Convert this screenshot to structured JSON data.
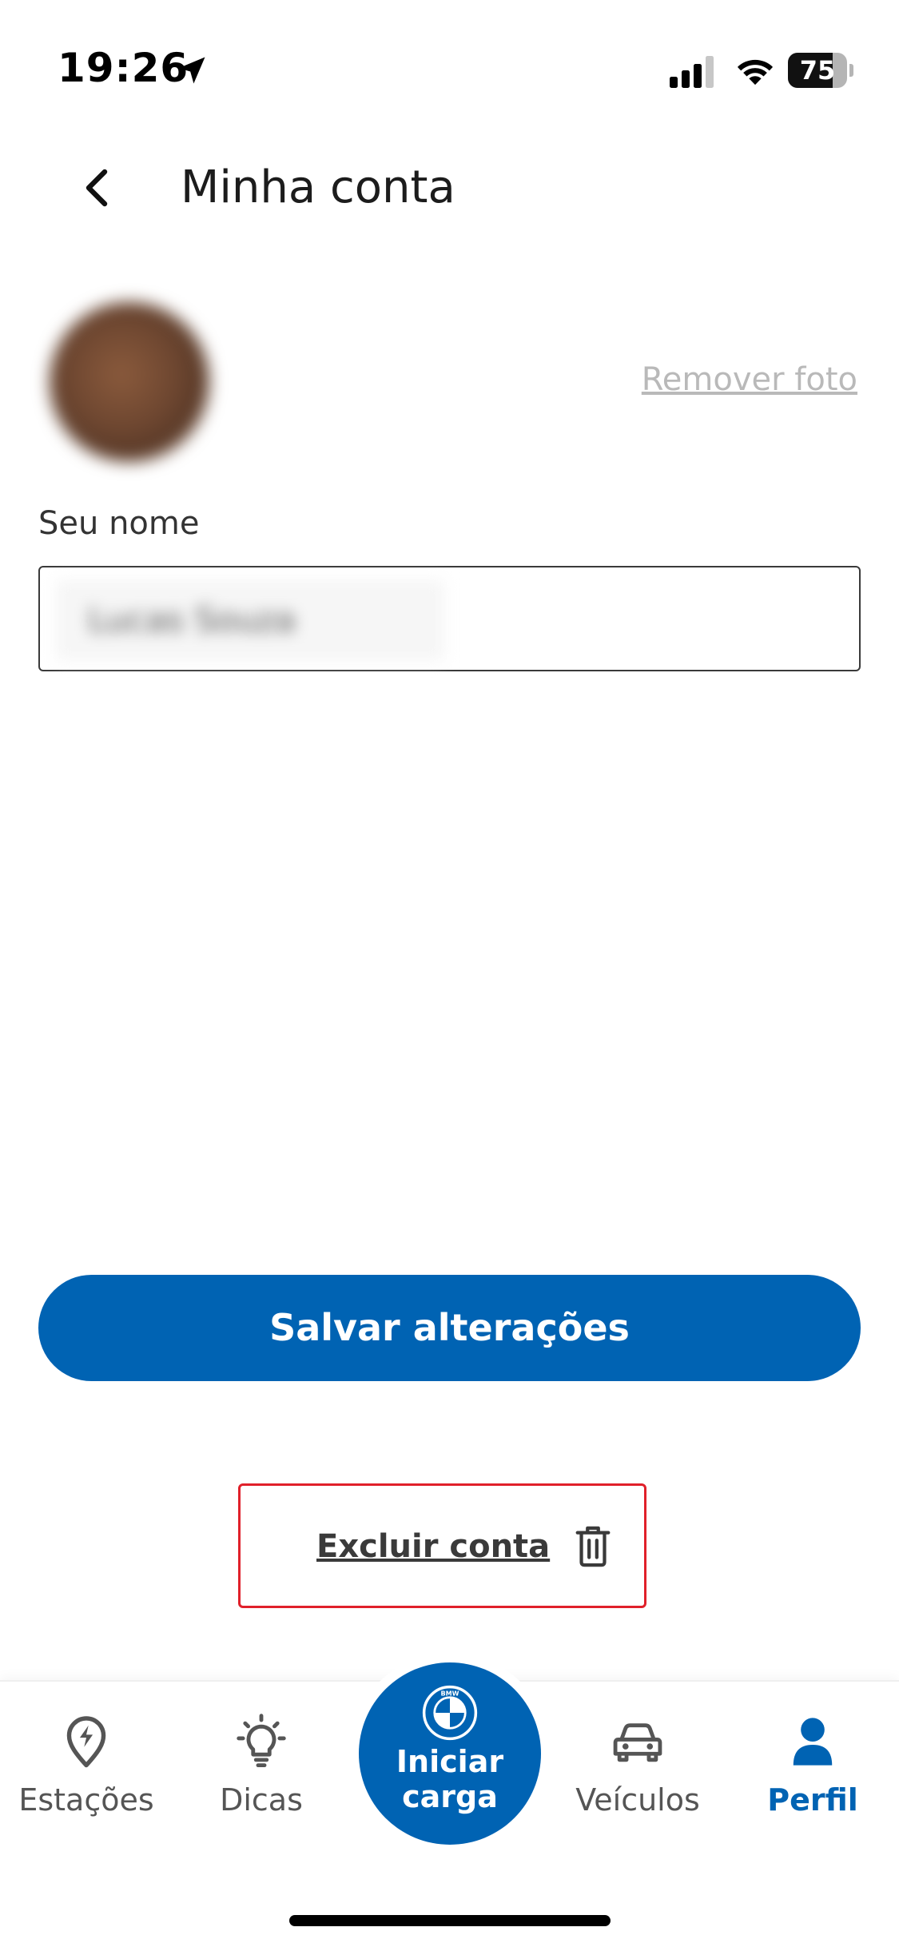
{
  "status_bar": {
    "time": "19:26",
    "battery_level": "75",
    "battery_fraction": 0.75,
    "icons": [
      "location-arrow-icon",
      "cellular-signal-icon",
      "wifi-icon",
      "battery-icon"
    ]
  },
  "header": {
    "back_icon": "chevron-left-icon",
    "title": "Minha conta"
  },
  "profile": {
    "remove_photo_label": "Remover foto",
    "name_label": "Seu nome",
    "name_value": "Lucas Souza"
  },
  "actions": {
    "save_label": "Salvar alterações",
    "delete_label": "Excluir conta",
    "delete_icon": "trash-icon",
    "delete_highlight_color": "#e0202a"
  },
  "tab_bar": {
    "items": [
      {
        "label": "Estações",
        "icon": "charging-location-icon",
        "active": false
      },
      {
        "label": "Dicas",
        "icon": "lightbulb-icon",
        "active": false
      },
      {
        "label": "Iniciar carga",
        "icon": "bmw-logo-icon",
        "active": false
      },
      {
        "label": "Veículos",
        "icon": "car-icon",
        "active": false
      },
      {
        "label": "Perfil",
        "icon": "person-icon",
        "active": true
      }
    ]
  },
  "colors": {
    "primary": "#0063b3",
    "muted_text": "#b9b9b9"
  }
}
